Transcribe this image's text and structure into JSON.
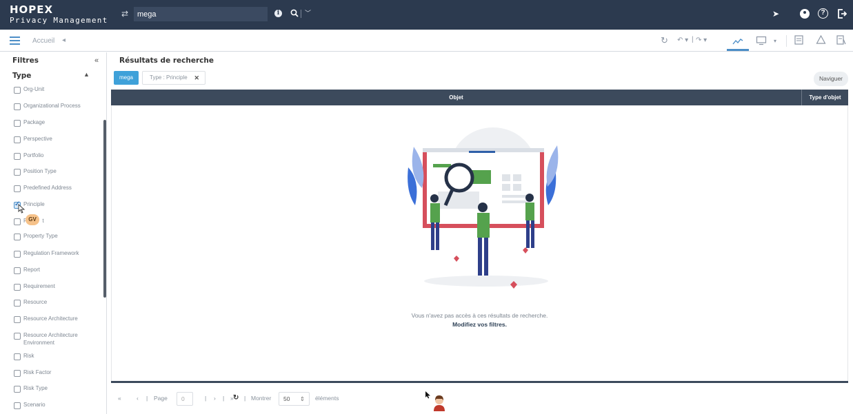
{
  "app": {
    "logo_line1": "HOPEX",
    "logo_line2": "Privacy Management",
    "search_value": "mega"
  },
  "secondary_bar": {
    "tab_label": "Accueil"
  },
  "sidebar": {
    "title": "Filtres",
    "section_title": "Type",
    "items": [
      {
        "label": "Org-Unit",
        "checked": false
      },
      {
        "label": "Organizational Process",
        "checked": false
      },
      {
        "label": "Package",
        "checked": false
      },
      {
        "label": "Perspective",
        "checked": false
      },
      {
        "label": "Portfolio",
        "checked": false
      },
      {
        "label": "Position Type",
        "checked": false
      },
      {
        "label": "Predefined Address",
        "checked": false
      },
      {
        "label": "Principle",
        "checked": true
      },
      {
        "label": "P",
        "suffix": "t",
        "checked": false
      },
      {
        "label": "Property Type",
        "checked": false
      },
      {
        "label": "Regulation Framework",
        "checked": false
      },
      {
        "label": "Report",
        "checked": false
      },
      {
        "label": "Requirement",
        "checked": false
      },
      {
        "label": "Resource",
        "checked": false
      },
      {
        "label": "Resource Architecture",
        "checked": false
      },
      {
        "label": "Resource Architecture Environment",
        "checked": false
      },
      {
        "label": "Risk",
        "checked": false
      },
      {
        "label": "Risk Factor",
        "checked": false
      },
      {
        "label": "Risk Type",
        "checked": false
      },
      {
        "label": "Scenario",
        "checked": false
      }
    ],
    "cursor_badge": "GV"
  },
  "main": {
    "title": "Résultats de recherche",
    "chips": {
      "search_term": "mega",
      "type_filter": "Type : Principle"
    },
    "naviguer_label": "Naviguer",
    "columns": [
      "Objet",
      "Type d'objet"
    ],
    "empty_message": "Vous n'avez pas accès à ces résultats de recherche.",
    "empty_link": "Modifiez vos filtres."
  },
  "pager": {
    "page_label": "Page",
    "page_value": "0",
    "show_label": "Montrer",
    "page_size": "50",
    "elements_label": "éléments"
  },
  "colors": {
    "topbar": "#2c3a4f",
    "accent": "#4c8ec7",
    "chip": "#3fa1d9",
    "grid_header": "#3c4a5c"
  }
}
